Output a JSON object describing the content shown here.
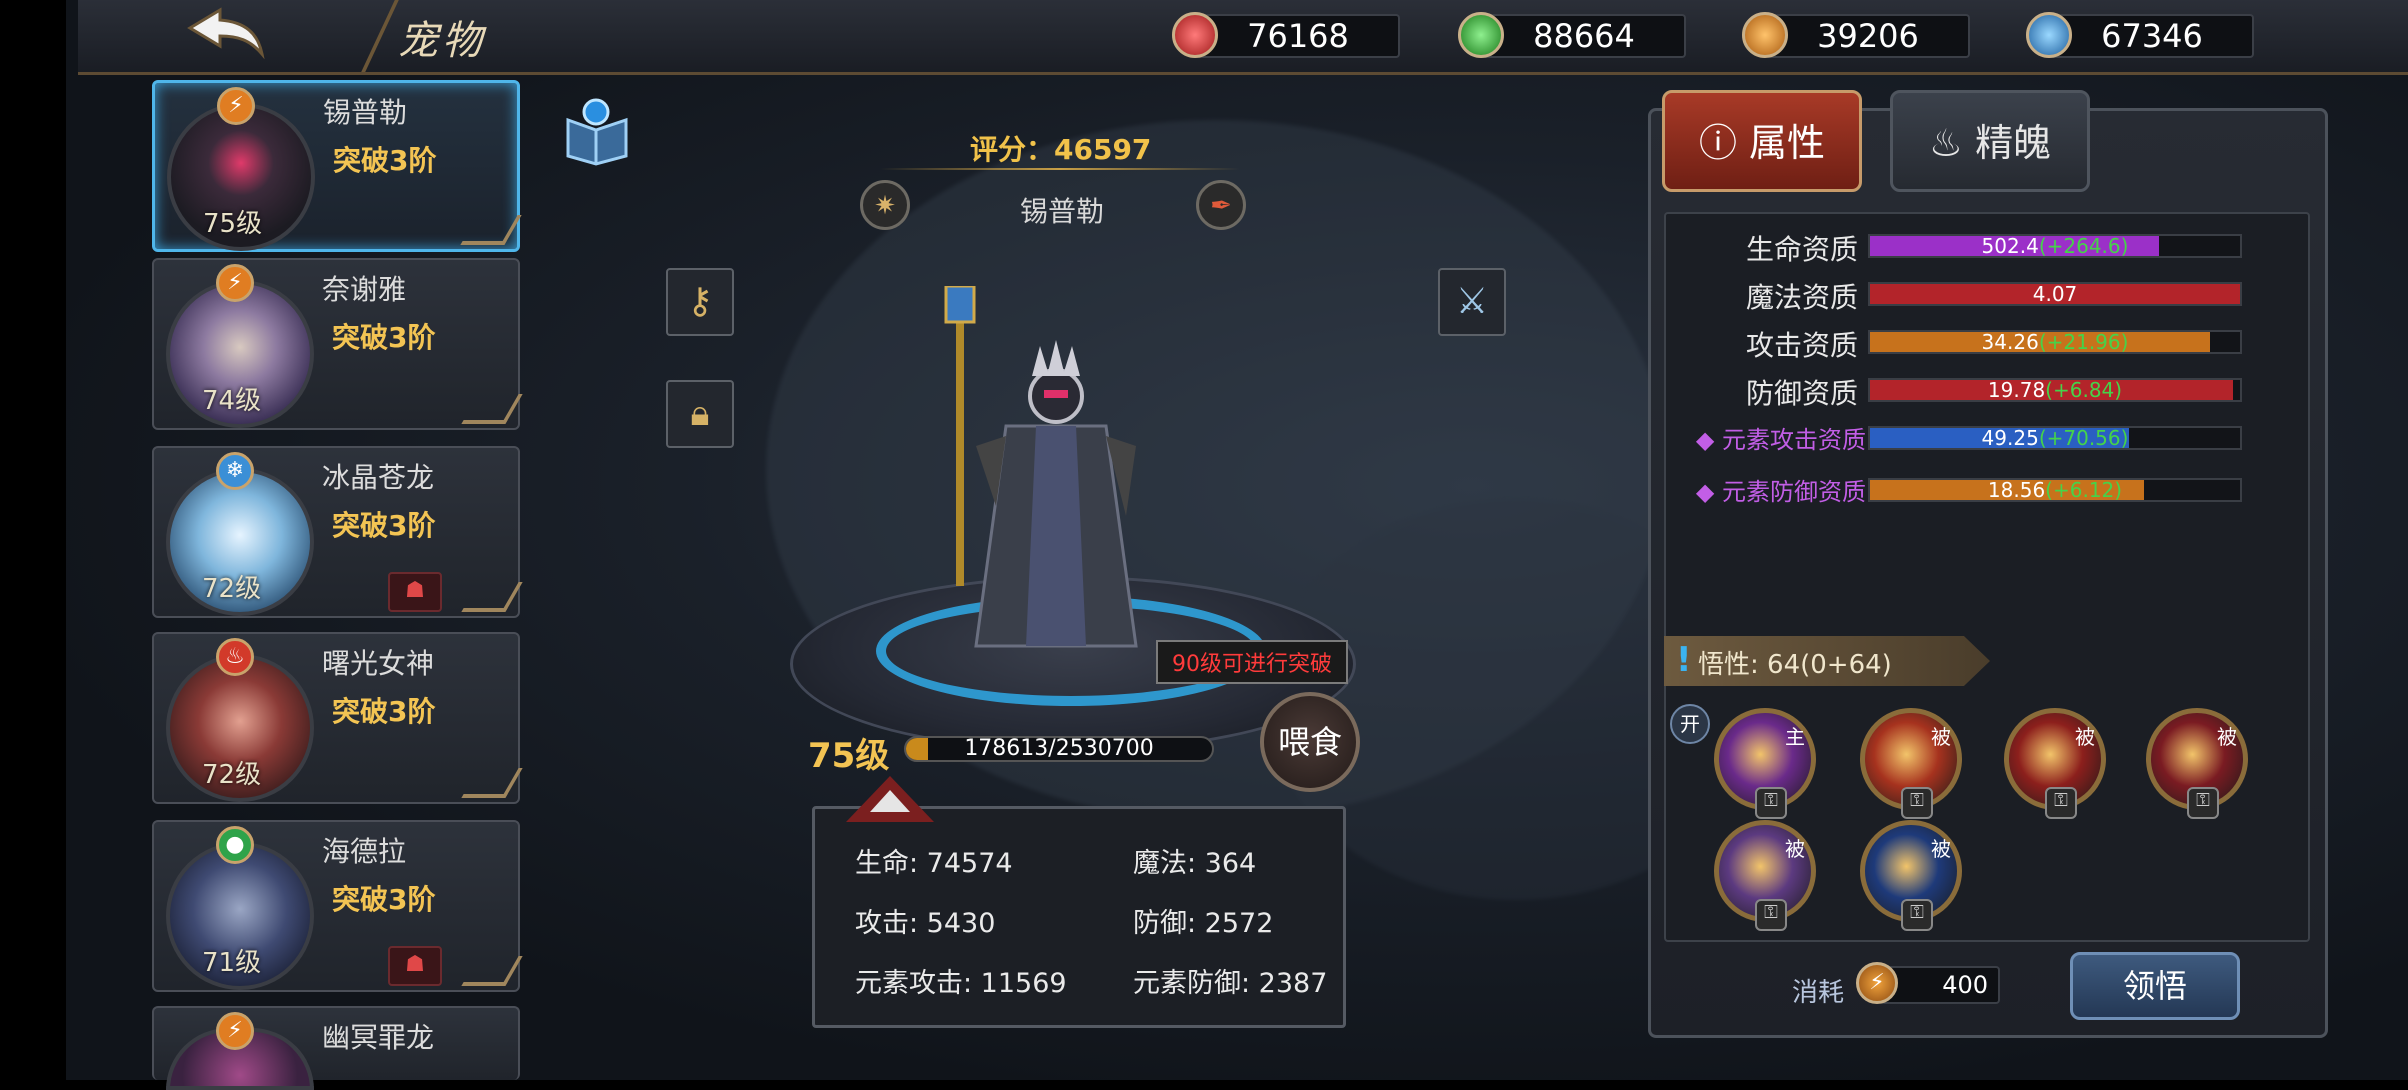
{
  "header": {
    "title": "宠物",
    "resources": [
      {
        "icon": "red-gem-icon",
        "color": "#d23a3a",
        "value": "76168"
      },
      {
        "icon": "green-gem-icon",
        "color": "#3fbf3f",
        "value": "88664"
      },
      {
        "icon": "orange-lightning-gem-icon",
        "color": "#f0962a",
        "value": "39206"
      },
      {
        "icon": "blue-snowflake-gem-icon",
        "color": "#3ba6e0",
        "value": "67346"
      }
    ]
  },
  "pets": [
    {
      "name": "锡普勒",
      "stage": "突破3阶",
      "level": "75级",
      "element": "⚡",
      "element_color": "#e07d22",
      "has_badge": false
    },
    {
      "name": "奈谢雅",
      "stage": "突破3阶",
      "level": "74级",
      "element": "⚡",
      "element_color": "#e07d22",
      "has_badge": false
    },
    {
      "name": "冰晶苍龙",
      "stage": "突破3阶",
      "level": "72级",
      "element": "❄",
      "element_color": "#3b8fd6",
      "has_badge": true
    },
    {
      "name": "曙光女神",
      "stage": "突破3阶",
      "level": "72级",
      "element": "🔥",
      "element_color": "#d23a2a",
      "has_badge": false
    },
    {
      "name": "海德拉",
      "stage": "突破3阶",
      "level": "71级",
      "element": "💧",
      "element_color": "#2fa34a",
      "has_badge": true
    },
    {
      "name": "幽冥罪龙",
      "stage": "",
      "level": "",
      "element": "⚡",
      "element_color": "#e07d22",
      "has_badge": false
    }
  ],
  "detail": {
    "score": "评分：46597",
    "name": "锡普勒",
    "tip": "90级可进行突破",
    "level": "75级",
    "exp": "178613/2530700",
    "exp_fraction": 0.0706,
    "feed_label": "喂食",
    "stats": {
      "hp": "生命: 74574",
      "mp": "魔法: 364",
      "atk": "攻击: 5430",
      "def": "防御: 2572",
      "eatk": "元素攻击: 11569",
      "edef": "元素防御: 2387"
    }
  },
  "panel": {
    "tab_attr": "属性",
    "tab_soul": "精魄",
    "attributes": [
      {
        "label": "生命资质",
        "value": "502.4",
        "bonus": "(+264.6)",
        "color": "#9b30c8",
        "fill": 0.78,
        "elemental": false
      },
      {
        "label": "魔法资质",
        "value": "4.07",
        "bonus": "",
        "color": "#b3242a",
        "fill": 1.0,
        "elemental": false
      },
      {
        "label": "攻击资质",
        "value": "34.26",
        "bonus": "(+21.96)",
        "color": "#c7721c",
        "fill": 0.92,
        "elemental": false
      },
      {
        "label": "防御资质",
        "value": "19.78",
        "bonus": "(+6.84)",
        "color": "#b3242a",
        "fill": 0.98,
        "elemental": false
      },
      {
        "label": "元素攻击资质",
        "value": "49.25",
        "bonus": "(+70.56)",
        "color": "#2a5fc2",
        "fill": 0.7,
        "elemental": true
      },
      {
        "label": "元素防御资质",
        "value": "18.56",
        "bonus": "(+6.12)",
        "color": "#c7721c",
        "fill": 0.74,
        "elemental": true
      }
    ],
    "wuxing": "悟性: 64(0+64)",
    "open_tag": "开",
    "skills": [
      {
        "tag": "主",
        "color": "#6a2a8a"
      },
      {
        "tag": "被",
        "color": "#a6321e"
      },
      {
        "tag": "被",
        "color": "#8c1f1c"
      },
      {
        "tag": "被",
        "color": "#7a1b22"
      },
      {
        "tag": "被",
        "color": "#5c3a80"
      },
      {
        "tag": "被",
        "color": "#1e3a7a"
      }
    ],
    "cost_label": "消耗",
    "cost_value": "400",
    "learn_label": "领悟"
  }
}
